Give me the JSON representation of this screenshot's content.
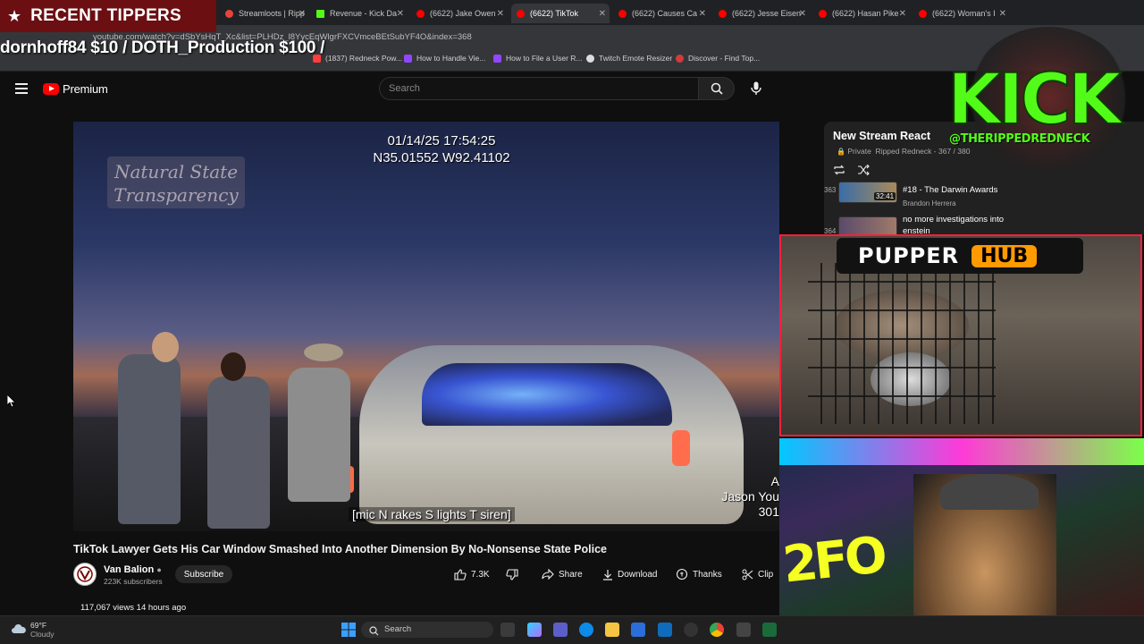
{
  "overlay": {
    "tippers_banner": "RECENT TIPPERS",
    "ticker": "dornhoff84 $10 / DOTH_Production $100 /",
    "kick_word": "KICK",
    "kick_handle": "@THERIPPEDREDNECK",
    "pupper_word": "PUPPER",
    "pupper_hub": "HUB",
    "webcam_sign": "2FO"
  },
  "browser": {
    "tabs": [
      {
        "label": "Streamloots | Ripp",
        "color": "#e6443a"
      },
      {
        "label": "Revenue - Kick Da",
        "color": "#53fc18"
      },
      {
        "label": "(6622) Jake Owen",
        "color": "#ff0000"
      },
      {
        "label": "(6622) TikTok",
        "color": "#ff0000"
      },
      {
        "label": "(6622) Causes Ca",
        "color": "#ff0000"
      },
      {
        "label": "(6622) Jesse Eisen",
        "color": "#ff0000"
      },
      {
        "label": "(6622) Hasan Pike",
        "color": "#ff0000"
      },
      {
        "label": "(6622) Woman's I",
        "color": "#ff0000"
      }
    ],
    "url": "youtube.com/watch?v=dSbYsHqT_Xc&list=PLHDz_l8YycEqWlgrFXCVmceBEtSubYF4O&index=368",
    "bookmarks": [
      {
        "label": "(1837) Redneck Pow...",
        "color": "#ff3d3d"
      },
      {
        "label": "How to Handle Vie...",
        "color": "#9146ff"
      },
      {
        "label": "How to File a User R...",
        "color": "#9146ff"
      },
      {
        "label": "Twitch Emote Resizer",
        "color": "#dddddd"
      },
      {
        "label": "Discover - Find Top...",
        "color": "#d23b3b"
      }
    ]
  },
  "youtube": {
    "logo_text": "Premium",
    "search_placeholder": "Search",
    "video_stamp_line1": "01/14/25 17:54:25",
    "video_stamp_line2": "N35.01552 W92.41102",
    "watermark_line1": "Natural State",
    "watermark_line2": "Transparency",
    "caption": "[mic N rakes S lights T siren]",
    "nameplate_line1": "A",
    "nameplate_line2": "Jason You",
    "nameplate_line3": "301",
    "video_title": "TikTok Lawyer Gets His Car Window Smashed Into Another Dimension By No-Nonsense State Police",
    "channel_name": "Van Balion",
    "channel_subs": "223K subscribers",
    "subscribe_label": "Subscribe",
    "like_count": "7.3K",
    "share_label": "Share",
    "download_label": "Download",
    "thanks_label": "Thanks",
    "clip_label": "Clip",
    "meta": "117,067 views  14 hours ago",
    "accent": "#ff0000"
  },
  "playlist": {
    "title": "New Stream React",
    "privacy": "Private",
    "owner": "Ripped Redneck",
    "position": "367 / 380",
    "items": [
      {
        "index": "363",
        "title": "#18 - The Darwin Awards",
        "channel": "Brandon Herrera",
        "duration": "32:41"
      },
      {
        "index": "364",
        "title": "no more investigations into",
        "title2": "enstein",
        "channel": ""
      }
    ]
  },
  "taskbar": {
    "temp": "69°F",
    "weather": "Cloudy",
    "search_label": "Search"
  }
}
